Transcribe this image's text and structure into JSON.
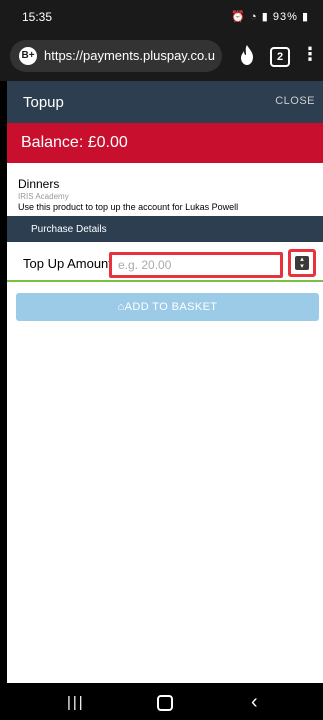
{
  "status_bar": {
    "time": "15:35",
    "battery": "93%",
    "icons": [
      "alarm-icon",
      "wifi-icon",
      "signal-icon",
      "battery-icon"
    ]
  },
  "browser": {
    "site_icon": "B+",
    "url": "https://payments.pluspay.co.u",
    "tab_count": "2"
  },
  "header": {
    "title": "Topup",
    "close_label": "CLOSE"
  },
  "balance": {
    "text": "Balance: £0.00"
  },
  "product": {
    "name": "Dinners",
    "school": "IRIS Academy",
    "description": "Use this product to top up the account for Lukas Powell"
  },
  "purchase": {
    "section_title": "Purchase Details",
    "amount_label": "Top Up Amount",
    "amount_placeholder": "e.g. 20.00",
    "add_button_label": "ADD TO BASKET"
  },
  "colors": {
    "header_bg": "#2c3e50",
    "balance_bg": "#c8102e",
    "highlight_border": "#e8333e",
    "button_bg": "#9ccbe8",
    "divider_green": "#7ac142"
  }
}
